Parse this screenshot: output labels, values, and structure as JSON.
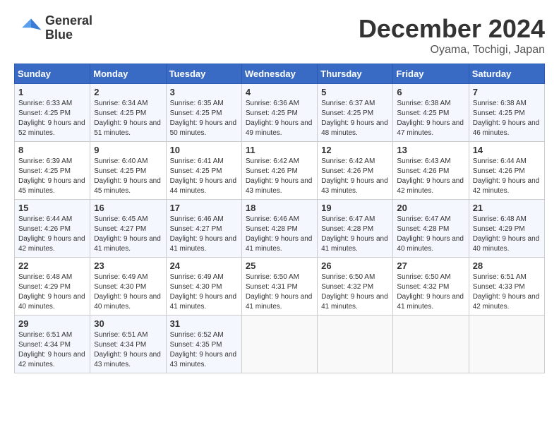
{
  "header": {
    "logo_line1": "General",
    "logo_line2": "Blue",
    "title": "December 2024",
    "subtitle": "Oyama, Tochigi, Japan"
  },
  "weekdays": [
    "Sunday",
    "Monday",
    "Tuesday",
    "Wednesday",
    "Thursday",
    "Friday",
    "Saturday"
  ],
  "weeks": [
    [
      {
        "day": "1",
        "sunrise": "6:33 AM",
        "sunset": "4:25 PM",
        "daylight": "9 hours and 52 minutes."
      },
      {
        "day": "2",
        "sunrise": "6:34 AM",
        "sunset": "4:25 PM",
        "daylight": "9 hours and 51 minutes."
      },
      {
        "day": "3",
        "sunrise": "6:35 AM",
        "sunset": "4:25 PM",
        "daylight": "9 hours and 50 minutes."
      },
      {
        "day": "4",
        "sunrise": "6:36 AM",
        "sunset": "4:25 PM",
        "daylight": "9 hours and 49 minutes."
      },
      {
        "day": "5",
        "sunrise": "6:37 AM",
        "sunset": "4:25 PM",
        "daylight": "9 hours and 48 minutes."
      },
      {
        "day": "6",
        "sunrise": "6:38 AM",
        "sunset": "4:25 PM",
        "daylight": "9 hours and 47 minutes."
      },
      {
        "day": "7",
        "sunrise": "6:38 AM",
        "sunset": "4:25 PM",
        "daylight": "9 hours and 46 minutes."
      }
    ],
    [
      {
        "day": "8",
        "sunrise": "6:39 AM",
        "sunset": "4:25 PM",
        "daylight": "9 hours and 45 minutes."
      },
      {
        "day": "9",
        "sunrise": "6:40 AM",
        "sunset": "4:25 PM",
        "daylight": "9 hours and 45 minutes."
      },
      {
        "day": "10",
        "sunrise": "6:41 AM",
        "sunset": "4:25 PM",
        "daylight": "9 hours and 44 minutes."
      },
      {
        "day": "11",
        "sunrise": "6:42 AM",
        "sunset": "4:26 PM",
        "daylight": "9 hours and 43 minutes."
      },
      {
        "day": "12",
        "sunrise": "6:42 AM",
        "sunset": "4:26 PM",
        "daylight": "9 hours and 43 minutes."
      },
      {
        "day": "13",
        "sunrise": "6:43 AM",
        "sunset": "4:26 PM",
        "daylight": "9 hours and 42 minutes."
      },
      {
        "day": "14",
        "sunrise": "6:44 AM",
        "sunset": "4:26 PM",
        "daylight": "9 hours and 42 minutes."
      }
    ],
    [
      {
        "day": "15",
        "sunrise": "6:44 AM",
        "sunset": "4:26 PM",
        "daylight": "9 hours and 42 minutes."
      },
      {
        "day": "16",
        "sunrise": "6:45 AM",
        "sunset": "4:27 PM",
        "daylight": "9 hours and 41 minutes."
      },
      {
        "day": "17",
        "sunrise": "6:46 AM",
        "sunset": "4:27 PM",
        "daylight": "9 hours and 41 minutes."
      },
      {
        "day": "18",
        "sunrise": "6:46 AM",
        "sunset": "4:28 PM",
        "daylight": "9 hours and 41 minutes."
      },
      {
        "day": "19",
        "sunrise": "6:47 AM",
        "sunset": "4:28 PM",
        "daylight": "9 hours and 41 minutes."
      },
      {
        "day": "20",
        "sunrise": "6:47 AM",
        "sunset": "4:28 PM",
        "daylight": "9 hours and 40 minutes."
      },
      {
        "day": "21",
        "sunrise": "6:48 AM",
        "sunset": "4:29 PM",
        "daylight": "9 hours and 40 minutes."
      }
    ],
    [
      {
        "day": "22",
        "sunrise": "6:48 AM",
        "sunset": "4:29 PM",
        "daylight": "9 hours and 40 minutes."
      },
      {
        "day": "23",
        "sunrise": "6:49 AM",
        "sunset": "4:30 PM",
        "daylight": "9 hours and 40 minutes."
      },
      {
        "day": "24",
        "sunrise": "6:49 AM",
        "sunset": "4:30 PM",
        "daylight": "9 hours and 41 minutes."
      },
      {
        "day": "25",
        "sunrise": "6:50 AM",
        "sunset": "4:31 PM",
        "daylight": "9 hours and 41 minutes."
      },
      {
        "day": "26",
        "sunrise": "6:50 AM",
        "sunset": "4:32 PM",
        "daylight": "9 hours and 41 minutes."
      },
      {
        "day": "27",
        "sunrise": "6:50 AM",
        "sunset": "4:32 PM",
        "daylight": "9 hours and 41 minutes."
      },
      {
        "day": "28",
        "sunrise": "6:51 AM",
        "sunset": "4:33 PM",
        "daylight": "9 hours and 42 minutes."
      }
    ],
    [
      {
        "day": "29",
        "sunrise": "6:51 AM",
        "sunset": "4:34 PM",
        "daylight": "9 hours and 42 minutes."
      },
      {
        "day": "30",
        "sunrise": "6:51 AM",
        "sunset": "4:34 PM",
        "daylight": "9 hours and 43 minutes."
      },
      {
        "day": "31",
        "sunrise": "6:52 AM",
        "sunset": "4:35 PM",
        "daylight": "9 hours and 43 minutes."
      },
      null,
      null,
      null,
      null
    ]
  ]
}
